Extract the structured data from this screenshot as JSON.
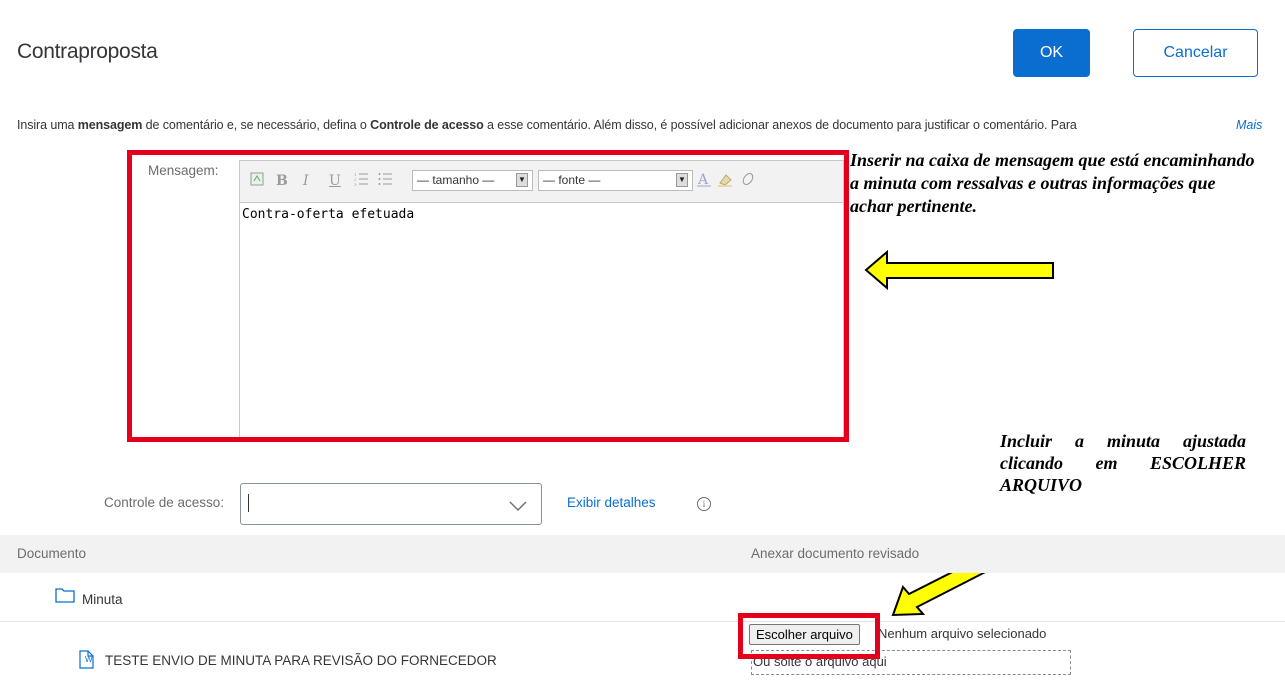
{
  "header": {
    "title": "Contraproposta",
    "ok_label": "OK",
    "cancel_label": "Cancelar"
  },
  "instructions": {
    "part1": "Insira uma ",
    "bold1": "mensagem",
    "part2": " de comentário e, se necessário, defina o ",
    "bold2": "Controle de acesso",
    "part3": " a esse comentário. Além disso, é possível adicionar anexos de documento para justificar o comentário. Para",
    "more_link": "Mais"
  },
  "message": {
    "label": "Mensagem:",
    "size_select": "— tamanho —",
    "font_select": "— fonte —",
    "content": "Contra-oferta efetuada"
  },
  "annotations": {
    "note_message": "Inserir na caixa de mensagem que está encaminhando a minuta com ressalvas e outras informações que achar pertinente.",
    "note_file": "Incluir a minuta ajustada clicando em ESCOLHER ARQUIVO",
    "highlight_color": "#e2001a",
    "arrow_color": "#ffff00"
  },
  "access_control": {
    "label": "Controle de acesso:",
    "value": "",
    "details_link": "Exibir detalhes"
  },
  "documents": {
    "col_document": "Documento",
    "col_attach": "Anexar documento revisado",
    "folder_name": "Minuta",
    "doc_name": "TESTE ENVIO DE MINUTA PARA REVISÃO DO FORNECEDOR",
    "choose_file_label": "Escolher arquivo",
    "no_file_text": "Nenhum arquivo selecionado",
    "drop_text": "Ou solte o arquivo aqui"
  },
  "colors": {
    "primary": "#0a6ed1"
  }
}
